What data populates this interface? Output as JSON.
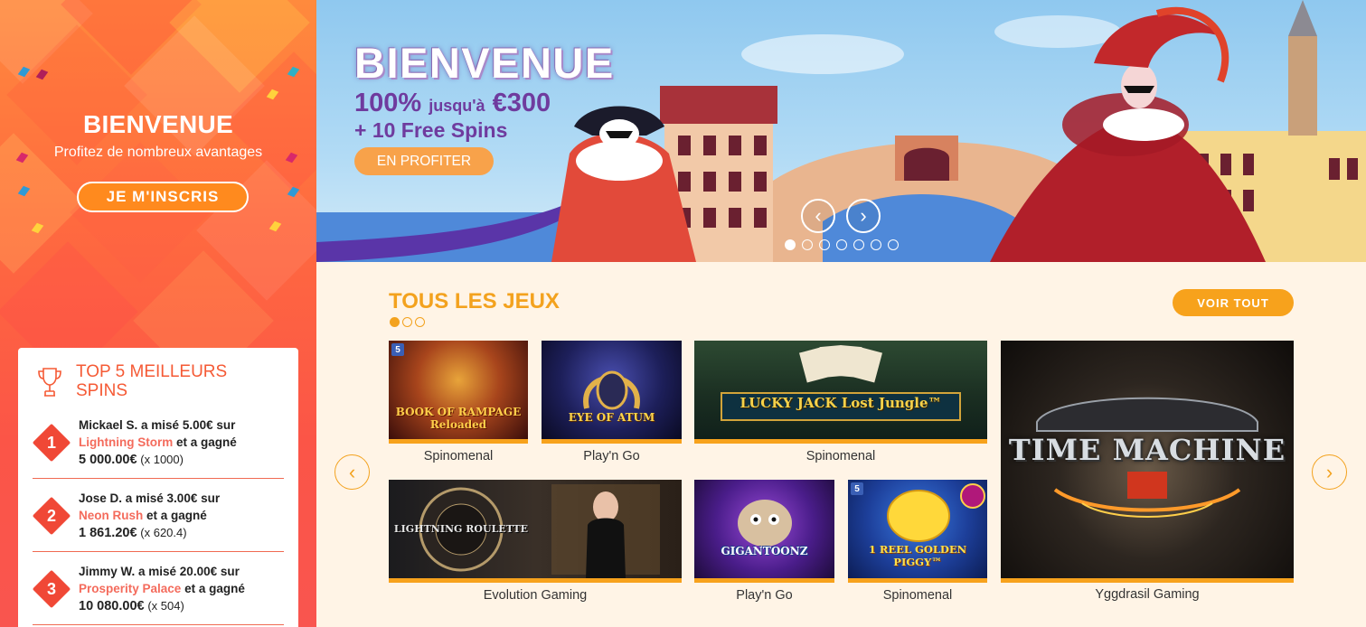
{
  "sidebar": {
    "welcome_title": "BIENVENUE",
    "welcome_subtitle": "Profitez de nombreux avantages",
    "signup_label": "JE M'INSCRIS",
    "top5": {
      "title_line1": "TOP 5 MEILLEURS",
      "title_line2": "SPINS",
      "entries": [
        {
          "rank": "1",
          "player_bet": "Mickael S. a misé 5.00€ sur",
          "game": "Lightning Storm",
          "won_text": "et a gagné",
          "amount": "5 000.00€",
          "multiplier": "(x 1000)"
        },
        {
          "rank": "2",
          "player_bet": "Jose D. a misé 3.00€ sur",
          "game": "Neon Rush",
          "won_text": "et a gagné",
          "amount": "1 861.20€",
          "multiplier": "(x 620.4)"
        },
        {
          "rank": "3",
          "player_bet": "Jimmy W. a misé 20.00€ sur",
          "game": "Prosperity Palace",
          "won_text": "et a gagné",
          "amount": "10 080.00€",
          "multiplier": "(x 504)"
        }
      ]
    }
  },
  "banner": {
    "title": "BIENVENUE",
    "offer_percent": "100%",
    "offer_upto": "jusqu'à",
    "offer_amount": "€300",
    "offer_spins": "+ 10 Free Spins",
    "cta_label": "EN PROFITER",
    "prev_icon": "‹",
    "next_icon": "›",
    "slide_count": 7,
    "active_slide": 1
  },
  "games_section": {
    "title": "TOUS LES JEUX",
    "view_all_label": "VOIR TOUT",
    "prev_icon": "‹",
    "next_icon": "›",
    "page_count": 3,
    "active_page": 1,
    "games": [
      {
        "name": "BOOK OF RAMPAGE Reloaded",
        "provider": "Spinomenal"
      },
      {
        "name": "EYE OF ATUM",
        "provider": "Play'n Go"
      },
      {
        "name": "LUCKY JACK Lost Jungle™",
        "provider": "Spinomenal"
      },
      {
        "name": "TIME MACHINE",
        "provider": "Yggdrasil Gaming"
      },
      {
        "name": "LIGHTNING ROULETTE",
        "provider": "Evolution Gaming"
      },
      {
        "name": "GIGANTOONZ",
        "provider": "Play'n Go"
      },
      {
        "name": "1 REEL GOLDEN PIGGY™",
        "provider": "Spinomenal"
      }
    ]
  },
  "colors": {
    "accent_orange": "#f7a21c",
    "sidebar_red": "#f55a35",
    "banner_purple": "#6f3b9e",
    "background": "#fff4e6"
  }
}
